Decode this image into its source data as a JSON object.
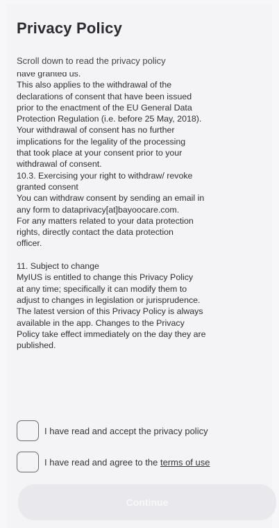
{
  "header": {
    "title": "Privacy Policy",
    "subtitle": "Scroll down to read the privacy policy"
  },
  "policy": {
    "lines": [
      "have granted us.",
      "This also applies to the withdrawal of the",
      "declarations of consent that have been issued",
      "prior to the enactment of the EU General Data",
      "Protection Regulation (i.e. before 25 May, 2018).",
      "Your withdrawal of consent has no further",
      "implications for the legality of the processing",
      "that took place at your consent prior to your",
      "withdrawal of consent.",
      "10.3. Exercising your right to withdraw/ revoke",
      "granted consent",
      "You can withdraw consent by sending an email in",
      "any form to dataprivacy[at]bayoocare.com.",
      "For any matters related to your data protection",
      "rights, directly contact the data protection",
      "officer.",
      "",
      "11. Subject to change",
      "MyIUS is entitled to change this Privacy Policy",
      "at any time; specifically it can modify them to",
      "adjust to changes in legislation or jurisprudence.",
      "The latest version of this Privacy Policy is always",
      "available in the app. Changes to the Privacy",
      "Policy take effect immediately on the day they are",
      "published."
    ]
  },
  "consents": {
    "privacy_label": "I have read and accept the privacy policy",
    "terms_prefix": "I have read and agree to the ",
    "terms_link": "terms of use"
  },
  "actions": {
    "continue_label": "Continue"
  }
}
